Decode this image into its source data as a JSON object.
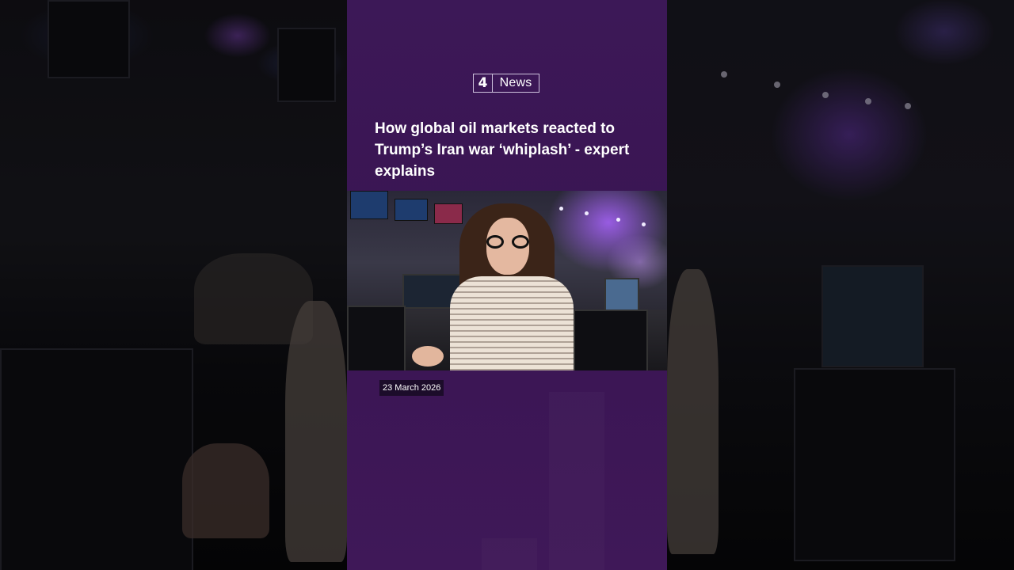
{
  "brand": {
    "logo_mark": "4",
    "logo_text": "News"
  },
  "article": {
    "headline": "How global oil markets reacted to Trump’s Iran war ‘whiplash’ - expert explains",
    "date": "23 March 2026"
  },
  "colors": {
    "panel_purple": "#3c1857",
    "date_badge": "#1c0c2a",
    "text": "#ffffff"
  }
}
